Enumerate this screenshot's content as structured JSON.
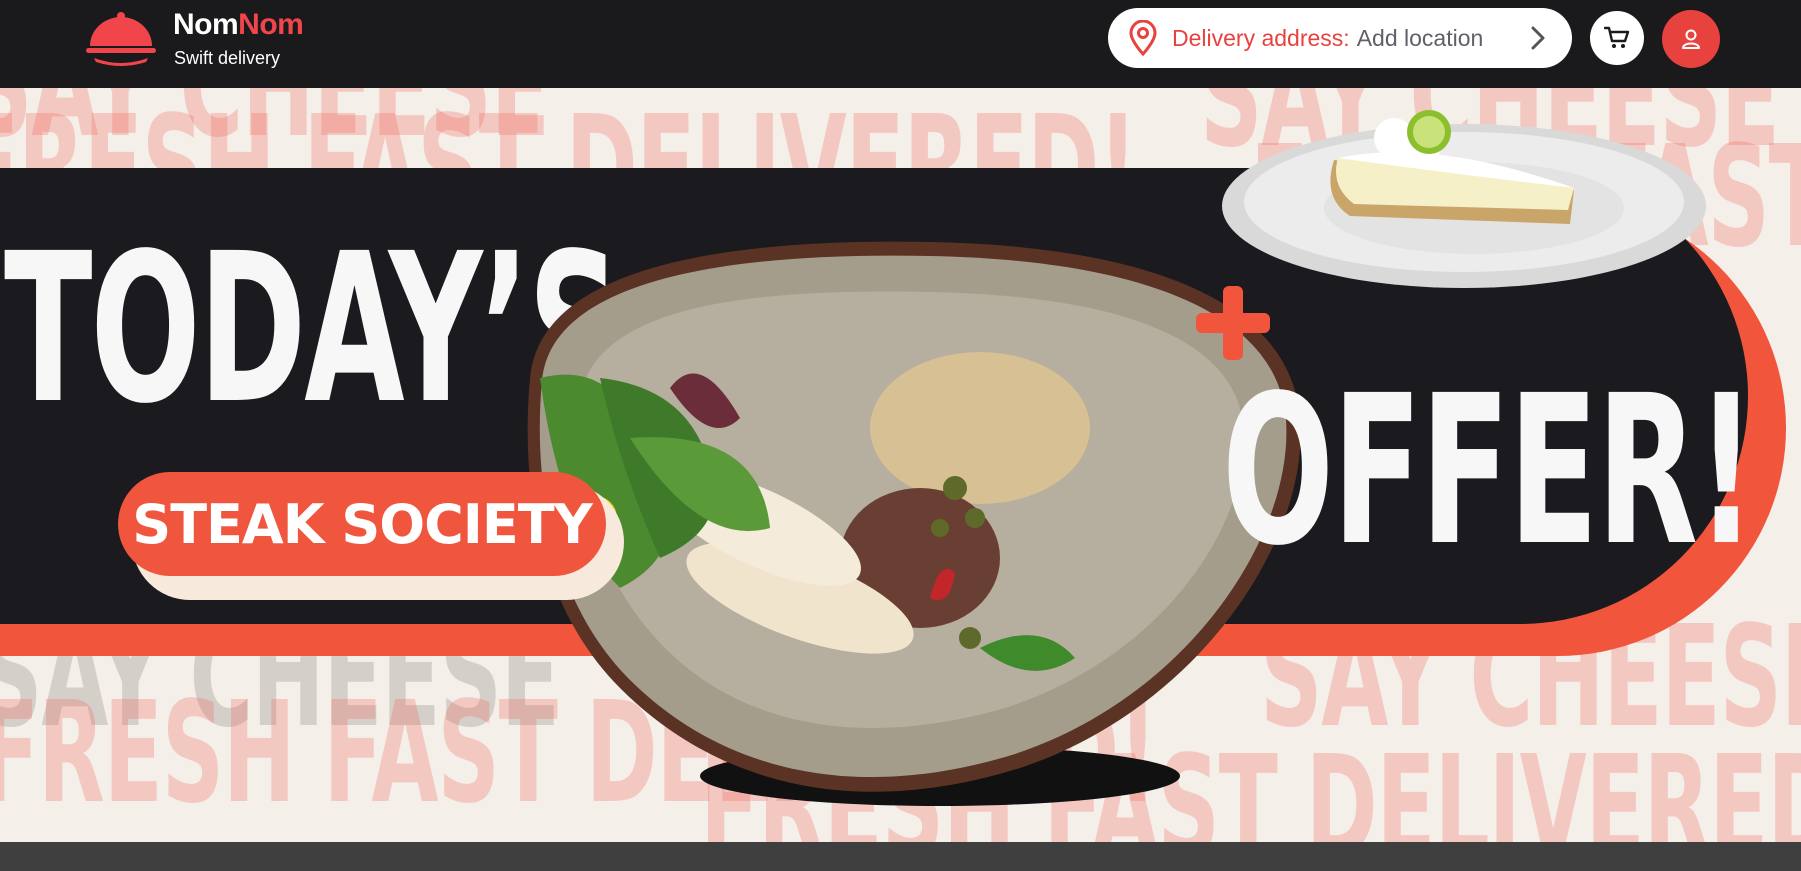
{
  "header": {
    "brand_main": "Nom",
    "brand_accent": "Nom",
    "tagline": "Swift delivery",
    "address_label": "Delivery address:",
    "address_value": "Add location",
    "icons": [
      "cloche-logo-icon",
      "location-pin-icon",
      "chevron-right-icon",
      "cart-icon",
      "user-icon"
    ]
  },
  "banner": {
    "headline_left": "TODAY’S",
    "headline_right": "OFFER!",
    "restaurant": "STEAK SOCIETY",
    "background_words": {
      "row1": "SAY CHEESE",
      "row2": "FRESH FAST DELIVERED!",
      "row3": "SAY CHEESE",
      "row4": "FRESH FAST DELIVERED!"
    }
  },
  "colors": {
    "accent_red": "#e8423f",
    "banner_orange": "#f1553c",
    "dark": "#1a1a1d",
    "banner_bg": "#f4efe9"
  }
}
